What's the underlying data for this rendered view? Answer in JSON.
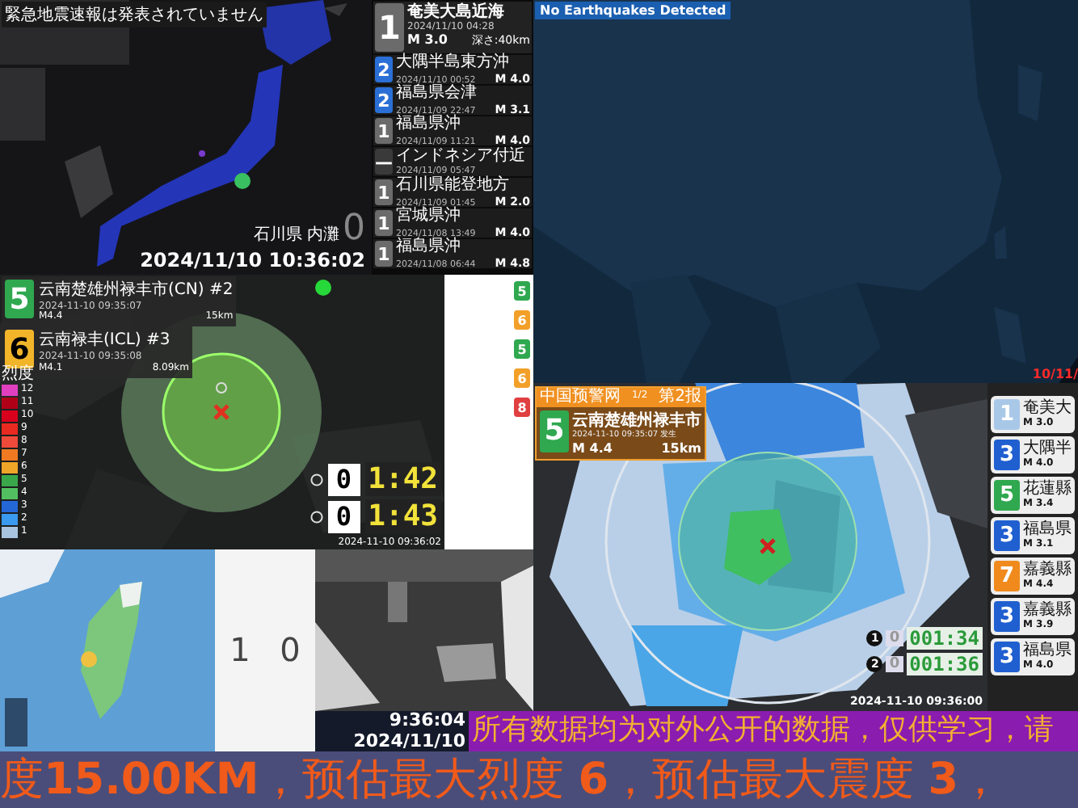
{
  "japan_panel": {
    "alert_text": "緊急地震速報は発表されていません",
    "location": "石川県 内灘",
    "observed_intensity": "0",
    "timestamp": "2024/11/10 10:36:02",
    "latest": {
      "intensity": "1",
      "color": "#6b6b6b",
      "name": "奄美大島近海",
      "time": "2024/11/10 04:28",
      "magnitude": "M 3.0",
      "depth": "深さ:40km"
    },
    "history": [
      {
        "intensity": "2",
        "color": "#2a6fd6",
        "name": "大隅半島東方沖",
        "time": "2024/11/10 00:52",
        "magnitude": "M 4.0"
      },
      {
        "intensity": "2",
        "color": "#2a6fd6",
        "name": "福島県会津",
        "time": "2024/11/09 22:47",
        "magnitude": "M 3.1"
      },
      {
        "intensity": "1",
        "color": "#6b6b6b",
        "name": "福島県沖",
        "time": "2024/11/09 11:21",
        "magnitude": "M 4.0"
      },
      {
        "intensity": "—",
        "color": "#3a3a3a",
        "name": "インドネシア付近",
        "time": "2024/11/09 05:47"
      },
      {
        "intensity": "1",
        "color": "#6b6b6b",
        "name": "石川県能登地方",
        "time": "2024/11/09 01:45",
        "magnitude": "M 2.0"
      },
      {
        "intensity": "1",
        "color": "#6b6b6b",
        "name": "宮城県沖",
        "time": "2024/11/08 13:49",
        "magnitude": "M 4.0"
      },
      {
        "intensity": "1",
        "color": "#6b6b6b",
        "name": "福島県沖",
        "time": "2024/11/08 06:44",
        "magnitude": "M 4.8"
      }
    ]
  },
  "global_panel": {
    "status": "No Earthquakes Detected",
    "date_fragment": "10/11/"
  },
  "china_panel": {
    "alerts": [
      {
        "intensity": "5",
        "color": "#2fa84f",
        "name": "云南楚雄州禄丰市(CN) #2",
        "time": "2024-11-10 09:35:07",
        "magnitude": "M4.4",
        "depth": "15km"
      },
      {
        "intensity": "6",
        "color": "#f2b52a",
        "name": "云南禄丰(ICL) #3",
        "time": "2024-11-10 09:35:08",
        "magnitude": "M4.1",
        "depth": "8.09km"
      }
    ],
    "legend": {
      "title": "烈度",
      "levels": [
        {
          "label": "12",
          "color": "#e040c0"
        },
        {
          "label": "11",
          "color": "#b00018"
        },
        {
          "label": "10",
          "color": "#d8001c"
        },
        {
          "label": "9",
          "color": "#e82a20"
        },
        {
          "label": "8",
          "color": "#f04a3a"
        },
        {
          "label": "7",
          "color": "#f07a22"
        },
        {
          "label": "6",
          "color": "#f0a428"
        },
        {
          "label": "5",
          "color": "#3aa84a"
        },
        {
          "label": "4",
          "color": "#52c060"
        },
        {
          "label": "3",
          "color": "#2468d8"
        },
        {
          "label": "2",
          "color": "#3a9af0"
        },
        {
          "label": "1",
          "color": "#a8c4e0"
        }
      ]
    },
    "countdowns": [
      {
        "intensity": "0",
        "time": "1:42"
      },
      {
        "intensity": "0",
        "time": "1:43"
      }
    ],
    "timestamp": "2024-11-10 09:36:02",
    "side_list": [
      {
        "intensity": "5",
        "color": "#2fa84f"
      },
      {
        "intensity": "6",
        "color": "#f2a028"
      },
      {
        "intensity": "5",
        "color": "#2fa84f"
      },
      {
        "intensity": "6",
        "color": "#f2a028"
      },
      {
        "intensity": "8",
        "color": "#e04040"
      }
    ]
  },
  "yunnan_panel": {
    "header": {
      "source": "中国预警网",
      "page": "1/2",
      "report": "第2报",
      "intensity": "5",
      "color": "#2fa84f",
      "name": "云南楚雄州禄丰市",
      "time": "2024-11-10 09:35:07 发生",
      "magnitude": "M 4.4",
      "depth": "15km"
    },
    "countdowns": [
      {
        "index": "1",
        "intensity": "0",
        "time": "001:34"
      },
      {
        "index": "2",
        "intensity": "0",
        "time": "001:36"
      }
    ],
    "timestamp": "2024-11-10 09:36:00",
    "list": [
      {
        "intensity": "1",
        "color": "#a9c8e8",
        "name": "奄美大",
        "magnitude": "M 3.0"
      },
      {
        "intensity": "3",
        "color": "#1f5fd0",
        "name": "大隅半",
        "magnitude": "M 4.0"
      },
      {
        "intensity": "5",
        "color": "#2fa84f",
        "name": "花蓮縣",
        "magnitude": "M 3.4"
      },
      {
        "intensity": "3",
        "color": "#1f5fd0",
        "name": "福島県",
        "magnitude": "M 3.1"
      },
      {
        "intensity": "7",
        "color": "#f08a1c",
        "name": "嘉義縣",
        "magnitude": "M 4.4"
      },
      {
        "intensity": "3",
        "color": "#1f5fd0",
        "name": "嘉義縣",
        "magnitude": "M 3.9"
      },
      {
        "intensity": "3",
        "color": "#1f5fd0",
        "name": "福島県",
        "magnitude": "M 4.0"
      }
    ]
  },
  "taiwan_panel": {
    "counts": [
      "1",
      "0"
    ]
  },
  "clock": {
    "time": "9:36:04",
    "date": "2024/11/10"
  },
  "banner": "所有数据均为对外公开的数据，仅供学习，请",
  "ticker": "度**15.00KM**，预估最大烈度 **6**，预估最大震度 **3**，"
}
